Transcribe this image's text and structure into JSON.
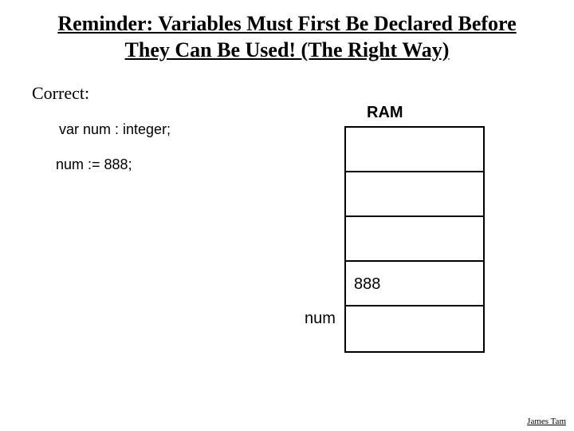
{
  "title_line1": "Reminder: Variables Must First Be Declared Before",
  "title_line2": "They Can Be Used! (The Right Way)",
  "correct_label": "Correct:",
  "code_line1": "var num : integer;",
  "code_line2": "num := 888;",
  "ram_label": "RAM",
  "ram_cells": [
    "",
    "",
    "",
    "888",
    ""
  ],
  "num_label": "num",
  "author": "James Tam"
}
